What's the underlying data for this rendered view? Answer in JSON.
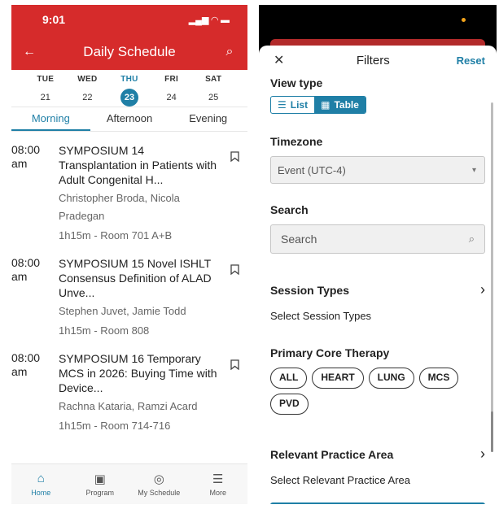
{
  "left": {
    "status_time": "9:01",
    "status_icons": "▂▄▆ ◠ ▬",
    "header": {
      "back_icon": "←",
      "title": "Daily Schedule",
      "search_icon": "⌕"
    },
    "days": [
      {
        "name": "TUE",
        "num": "21",
        "active": false
      },
      {
        "name": "WED",
        "num": "22",
        "active": false
      },
      {
        "name": "THU",
        "num": "23",
        "active": true
      },
      {
        "name": "FRI",
        "num": "24",
        "active": false
      },
      {
        "name": "SAT",
        "num": "25",
        "active": false
      }
    ],
    "tabs": [
      {
        "label": "Morning",
        "active": true
      },
      {
        "label": "Afternoon",
        "active": false
      },
      {
        "label": "Evening",
        "active": false
      }
    ],
    "sessions": [
      {
        "time": "08:00 am",
        "title": "SYMPOSIUM 14 Transplantation in Patients with Adult Congenital H...",
        "authors": "Christopher Broda, Nicola Pradegan",
        "meta": "1h15m - Room 701 A+B"
      },
      {
        "time": "08:00 am",
        "title": "SYMPOSIUM 15 Novel ISHLT Consensus Definition of ALAD Unve...",
        "authors": "Stephen Juvet, Jamie Todd",
        "meta": "1h15m - Room 808"
      },
      {
        "time": "08:00 am",
        "title": "SYMPOSIUM 16 Temporary MCS in 2026: Buying Time with Device...",
        "authors": "Rachna Kataria, Ramzi Acard",
        "meta": "1h15m - Room 714-716"
      }
    ],
    "nav": [
      {
        "label": "Home",
        "icon": "⌂",
        "active": true
      },
      {
        "label": "Program",
        "icon": "▣",
        "active": false
      },
      {
        "label": "My Schedule",
        "icon": "◎",
        "active": false
      },
      {
        "label": "More",
        "icon": "☰",
        "active": false
      }
    ]
  },
  "right": {
    "header": {
      "close_icon": "✕",
      "title": "Filters",
      "reset": "Reset"
    },
    "view_type": {
      "label": "View type",
      "options": [
        {
          "label": "List",
          "icon": "☰",
          "active": false
        },
        {
          "label": "Table",
          "icon": "▦",
          "active": true
        }
      ]
    },
    "timezone": {
      "label": "Timezone",
      "value": "Event (UTC-4)",
      "chevron": "▾"
    },
    "search": {
      "label": "Search",
      "placeholder": "Search",
      "icon": "⌕"
    },
    "session_types": {
      "label": "Session Types",
      "sub": "Select Session Types",
      "chevron": "›"
    },
    "core_therapy": {
      "label": "Primary Core Therapy",
      "chips": [
        "ALL",
        "HEART",
        "LUNG",
        "MCS",
        "PVD"
      ]
    },
    "practice_area": {
      "label": "Relevant Practice Area",
      "sub": "Select Relevant Practice Area",
      "chevron": "›"
    }
  }
}
